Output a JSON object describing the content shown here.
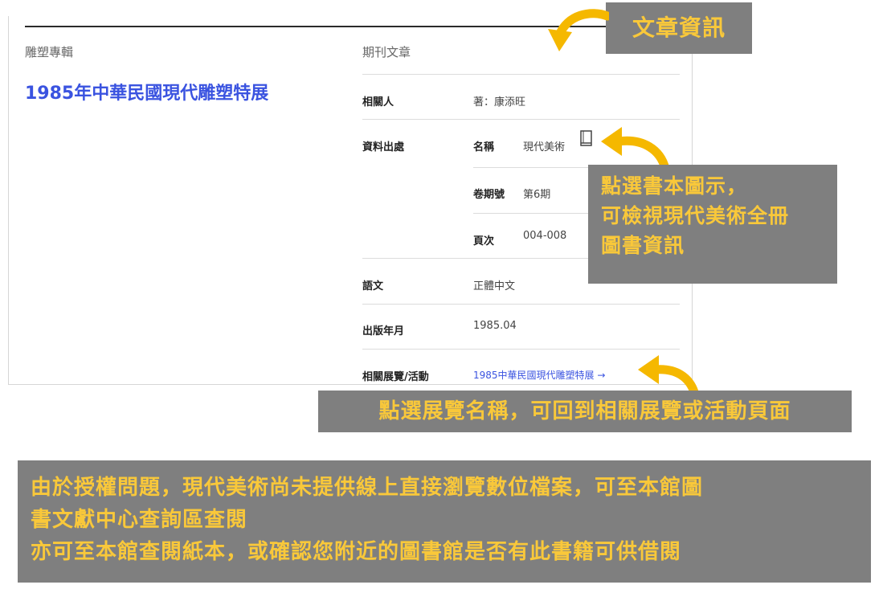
{
  "record": {
    "category": "雕塑專輯",
    "title": "1985年中華民國現代雕塑特展",
    "section_heading": "期刊文章",
    "people_label": "相關人",
    "people_value": "著：康添旺",
    "source_label": "資料出處",
    "name_label": "名稱",
    "name_value": "現代美術",
    "issue_label": "卷期號",
    "issue_value": "第6期",
    "pages_label": "頁次",
    "pages_value": "004-008",
    "language_label": "語文",
    "language_value": "正體中文",
    "pubdate_label": "出版年月",
    "pubdate_value": "1985.04",
    "exhibition_label": "相關展覽/活動",
    "exhibition_link": "1985中華民國現代雕塑特展 →"
  },
  "icons": {
    "book": "book-icon"
  },
  "callouts": {
    "article_info": "文章資訊",
    "book_icon_note": [
      "點選書本圖示，",
      "可檢視現代美術全冊",
      "圖書資訊"
    ],
    "exhibition_note": "點選展覽名稱，可回到相關展覽或活動頁面",
    "footer_note": [
      "由於授權問題，現代美術尚未提供線上直接瀏覽數位檔案，可至本館圖",
      "書文獻中心查詢區查閱",
      "亦可至本館查閱紙本，或確認您附近的圖書館是否有此書籍可供借閱"
    ]
  },
  "colors": {
    "callout_bg": "#7f7f7f",
    "callout_text": "#f9c83a",
    "arrow": "#f5b800",
    "title_blue": "#3a53e0"
  }
}
